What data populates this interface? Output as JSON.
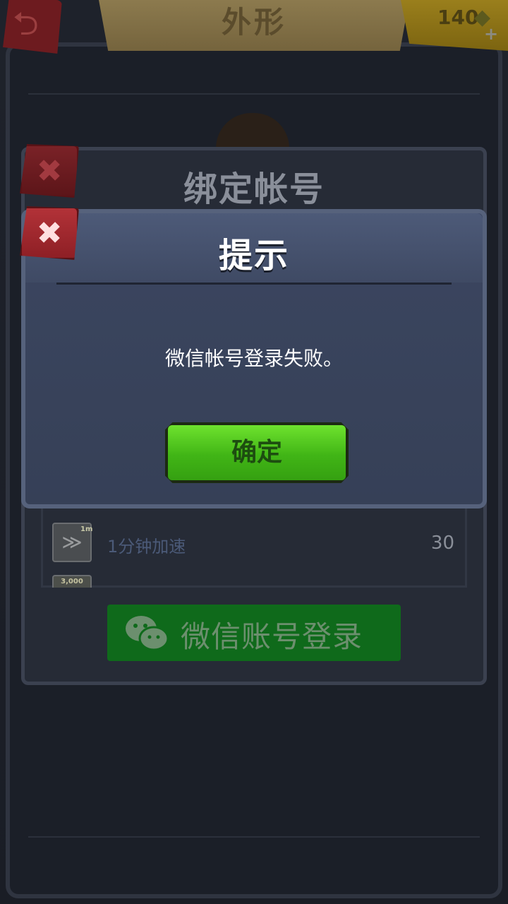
{
  "top_bar": {
    "title": "外形",
    "gem_count": "140",
    "back_icon": "back-arrow-icon",
    "gem_icon": "diamond-icon",
    "plus_icon": "plus-icon"
  },
  "bind_panel": {
    "title": "绑定帐号",
    "close_icon": "close-icon"
  },
  "items": [
    {
      "tag": "1m",
      "label": "1分钟加速",
      "value": "30"
    },
    {
      "tag": "3,000"
    }
  ],
  "wechat_button": {
    "label": "微信账号登录",
    "icon": "wechat-icon"
  },
  "prompt": {
    "title": "提示",
    "message": "微信帐号登录失败。",
    "confirm_label": "确定",
    "close_icon": "close-icon"
  },
  "colors": {
    "accent_green": "#41b516",
    "wechat_green": "#0f6a1b",
    "close_red": "#b23238",
    "panel_blue": "#3b4660"
  }
}
